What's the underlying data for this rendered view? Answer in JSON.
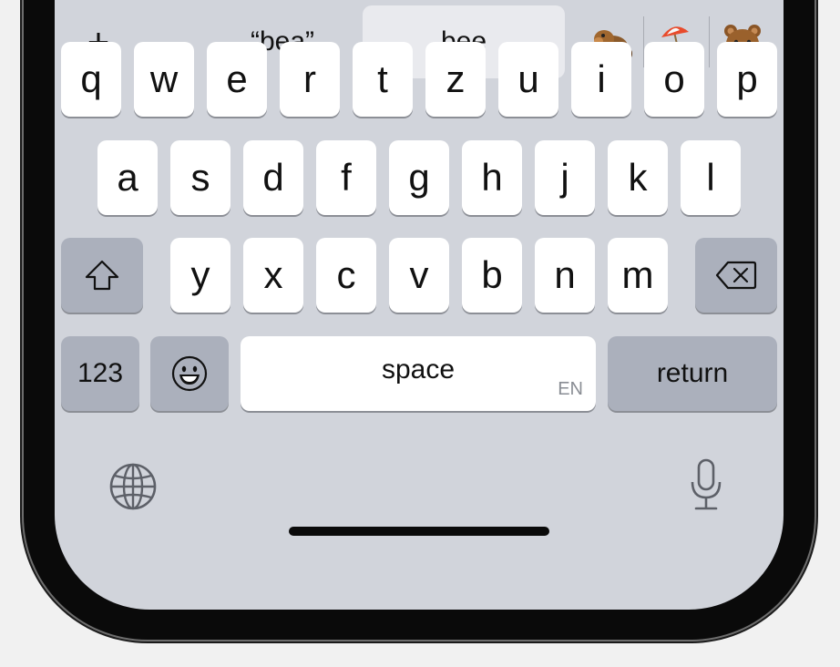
{
  "suggestions": {
    "add": "+",
    "quoted_word": "“bea”",
    "word": "bee",
    "emojis": [
      {
        "name": "beaver",
        "glyph": "🦫"
      },
      {
        "name": "beach-with-umbrella",
        "glyph": "🏖️"
      },
      {
        "name": "bear",
        "glyph": "🐻"
      }
    ]
  },
  "keyboard": {
    "row1": [
      "q",
      "w",
      "e",
      "r",
      "t",
      "z",
      "u",
      "i",
      "o",
      "p"
    ],
    "row2": [
      "a",
      "s",
      "d",
      "f",
      "g",
      "h",
      "j",
      "k",
      "l"
    ],
    "row3": [
      "y",
      "x",
      "c",
      "v",
      "b",
      "n",
      "m"
    ],
    "numbers_label": "123",
    "space_label": "space",
    "space_language": "EN",
    "return_label": "return"
  },
  "icons": {
    "shift": "shift-arrow-icon",
    "delete": "backspace-icon",
    "emoji": "smiley-face-icon",
    "globe": "globe-icon",
    "mic": "microphone-icon"
  },
  "colors": {
    "keyboard_bg": "#d1d4db",
    "key": "#ffffff",
    "function_key": "#abb0bc",
    "selected_suggestion": "#e9eaee"
  }
}
